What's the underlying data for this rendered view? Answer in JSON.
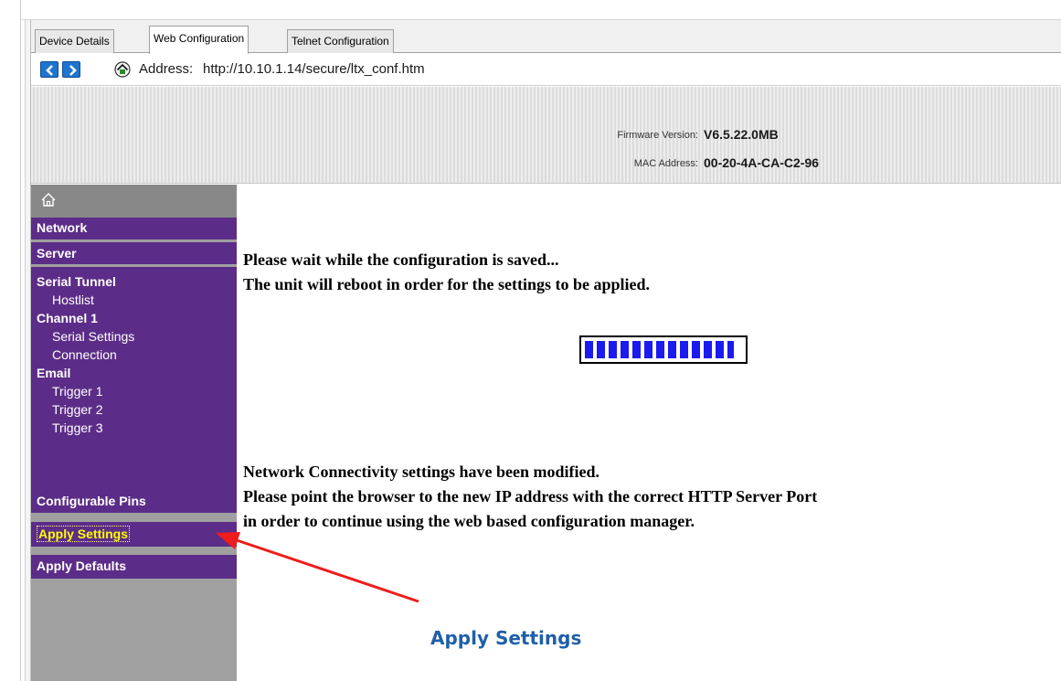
{
  "tabs": [
    {
      "label": "Device Details",
      "active": false
    },
    {
      "label": "Web Configuration",
      "active": true
    },
    {
      "label": "Telnet Configuration",
      "active": false
    }
  ],
  "address": {
    "label": "Address:",
    "url": "http://10.10.1.14/secure/ltx_conf.htm"
  },
  "header": {
    "firmware_label": "Firmware Version:",
    "firmware_value": "V6.5.22.0MB",
    "mac_label": "MAC Address:",
    "mac_value": "00-20-4A-CA-C2-96"
  },
  "sidebar": {
    "group1": [
      {
        "label": "Network",
        "level": "head"
      }
    ],
    "group2": [
      {
        "label": "Server",
        "level": "head"
      }
    ],
    "group3": [
      {
        "label": "Serial Tunnel",
        "level": "head"
      },
      {
        "label": "Hostlist",
        "level": "sub"
      },
      {
        "label": "Channel 1",
        "level": "head"
      },
      {
        "label": "Serial Settings",
        "level": "sub"
      },
      {
        "label": "Connection",
        "level": "sub"
      },
      {
        "label": "Email",
        "level": "head"
      },
      {
        "label": "Trigger 1",
        "level": "sub"
      },
      {
        "label": "Trigger 2",
        "level": "sub"
      },
      {
        "label": "Trigger 3",
        "level": "sub"
      }
    ],
    "group4": [
      {
        "label": "Configurable Pins",
        "level": "head"
      }
    ],
    "apply_settings": "Apply Settings",
    "apply_defaults": "Apply Defaults"
  },
  "content": {
    "wait_line1": "Please wait while the configuration is saved...",
    "wait_line2": "The unit will reboot in order for the settings to be applied.",
    "progress_fraction": 0.95,
    "notice_line1": "Network Connectivity settings have been modified.",
    "notice_line2": "Please point the browser to the new IP address with the correct HTTP Server Port",
    "notice_line3": "in order to continue using the web based configuration manager."
  },
  "annotation": {
    "label": "Apply Settings",
    "arrow_color": "#ee1c1c",
    "text_color": "#1f5fa8"
  },
  "colors": {
    "nav_purple": "#5c2d88",
    "nav_highlight": "#ffff00",
    "progress_blue": "#1b1bf0"
  }
}
